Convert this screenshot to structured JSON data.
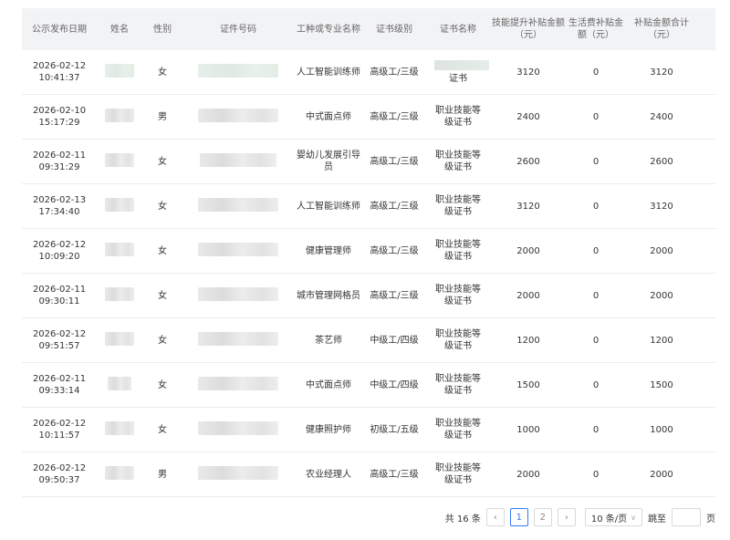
{
  "table": {
    "headers": [
      "公示发布日期",
      "姓名",
      "性别",
      "证件号码",
      "工种或专业名称",
      "证书级别",
      "证书名称",
      "技能提升补贴金额（元）",
      "生活费补贴金额（元）",
      "补贴金额合计（元）"
    ],
    "rows": [
      {
        "date": "2026-02-12",
        "time": "10:41:37",
        "gender": "女",
        "job": "人工智能训练师",
        "level": "高级工/三级",
        "cert": "证书",
        "skill": "3120",
        "living": "0",
        "total": "3120"
      },
      {
        "date": "2026-02-10",
        "time": "15:17:29",
        "gender": "男",
        "job": "中式面点师",
        "level": "高级工/三级",
        "cert": "职业技能等级证书",
        "skill": "2400",
        "living": "0",
        "total": "2400"
      },
      {
        "date": "2026-02-11",
        "time": "09:31:29",
        "gender": "女",
        "job": "婴幼儿发展引导员",
        "level": "高级工/三级",
        "cert": "职业技能等级证书",
        "skill": "2600",
        "living": "0",
        "total": "2600"
      },
      {
        "date": "2026-02-13",
        "time": "17:34:40",
        "gender": "女",
        "job": "人工智能训练师",
        "level": "高级工/三级",
        "cert": "职业技能等级证书",
        "skill": "3120",
        "living": "0",
        "total": "3120"
      },
      {
        "date": "2026-02-12",
        "time": "10:09:20",
        "gender": "女",
        "job": "健康管理师",
        "level": "高级工/三级",
        "cert": "职业技能等级证书",
        "skill": "2000",
        "living": "0",
        "total": "2000"
      },
      {
        "date": "2026-02-11",
        "time": "09:30:11",
        "gender": "女",
        "job": "城市管理网格员",
        "level": "高级工/三级",
        "cert": "职业技能等级证书",
        "skill": "2000",
        "living": "0",
        "total": "2000"
      },
      {
        "date": "2026-02-12",
        "time": "09:51:57",
        "gender": "女",
        "job": "茶艺师",
        "level": "中级工/四级",
        "cert": "职业技能等级证书",
        "skill": "1200",
        "living": "0",
        "total": "1200"
      },
      {
        "date": "2026-02-11",
        "time": "09:33:14",
        "gender": "女",
        "job": "中式面点师",
        "level": "中级工/四级",
        "cert": "职业技能等级证书",
        "skill": "1500",
        "living": "0",
        "total": "1500"
      },
      {
        "date": "2026-02-12",
        "time": "10:11:57",
        "gender": "女",
        "job": "健康照护师",
        "level": "初级工/五级",
        "cert": "职业技能等级证书",
        "skill": "1000",
        "living": "0",
        "total": "1000"
      },
      {
        "date": "2026-02-12",
        "time": "09:50:37",
        "gender": "男",
        "job": "农业经理人",
        "level": "高级工/三级",
        "cert": "职业技能等级证书",
        "skill": "2000",
        "living": "0",
        "total": "2000"
      }
    ]
  },
  "pagination": {
    "total_label": "共 16 条",
    "prev_icon": "chevron-left-icon",
    "next_icon": "chevron-right-icon",
    "pages": [
      "1",
      "2"
    ],
    "current_page": "1",
    "page_size": "10 条/页",
    "jump_label": "跳至",
    "page_suffix": "页"
  },
  "colors": {
    "header_bg": "#f2f3f5",
    "accent": "#2f7cf6",
    "border": "#ececec"
  }
}
